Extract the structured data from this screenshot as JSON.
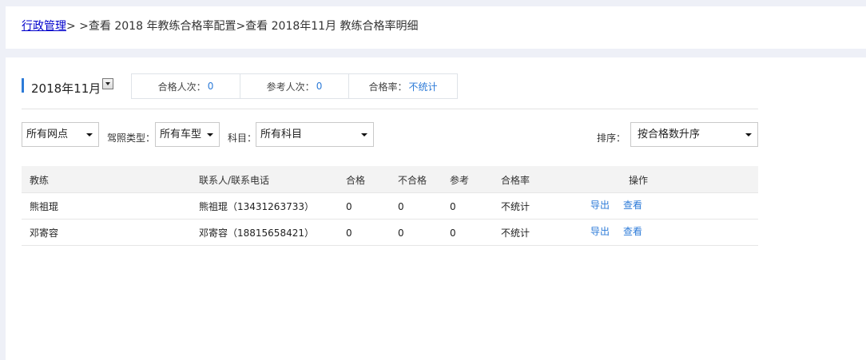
{
  "breadcrumb": {
    "root_link": "行政管理",
    "sep1": ">",
    "rest": " >查看 2018 年教练合格率配置>查看 2018年11月 教练合格率明细"
  },
  "period": {
    "title": "2018年11月"
  },
  "stats": [
    {
      "label": "合格人次：",
      "value": "0"
    },
    {
      "label": "参考人次：",
      "value": "0"
    },
    {
      "label": "合格率：",
      "value": "不统计"
    }
  ],
  "filters": {
    "outlet": "所有网点",
    "license_label": "驾照类型：",
    "vehicle": "所有车型",
    "subject_label": "科目：",
    "subject": "所有科目",
    "sort_label": "排序：",
    "sort": "按合格数升序"
  },
  "table": {
    "columns": [
      "教练",
      "联系人/联系电话",
      "合格",
      "不合格",
      "参考",
      "合格率",
      "操作"
    ],
    "rows": [
      {
        "coach": "熊祖琨",
        "contact": "熊祖琨（13431263733）",
        "pass": "0",
        "fail": "0",
        "total": "0",
        "rate": "不统计",
        "export": "导出",
        "view": "查看"
      },
      {
        "coach": "邓寄容",
        "contact": "邓寄容（18815658421）",
        "pass": "0",
        "fail": "0",
        "total": "0",
        "rate": "不统计",
        "export": "导出",
        "view": "查看"
      }
    ]
  },
  "colors": {
    "accent": "#2d7bd8",
    "breadcrumb_link": "#0000cc",
    "page_bg": "#eef0f7"
  }
}
